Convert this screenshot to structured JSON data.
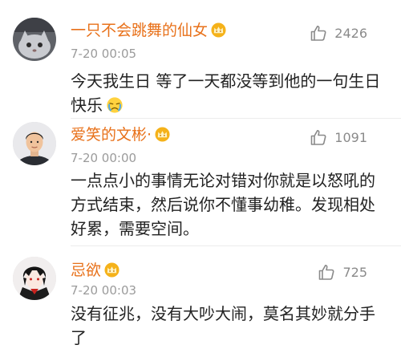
{
  "comments": [
    {
      "username": "一只不会跳舞的仙女",
      "avatar_icon": "grey-cat-avatar",
      "badge_icon": "vip-crown-badge-icon",
      "time": "7-20 00:05",
      "likes": "2426",
      "content": "今天我生日 等了一天都没等到他的一句生日快乐",
      "content_emoji": "sad-face-emoji"
    },
    {
      "username": "爱笑的文彬·",
      "avatar_icon": "young-man-avatar",
      "badge_icon": "vip-crown-badge-icon",
      "time": "7-20 00:00",
      "likes": "1091",
      "content": "一点点小的事情无论对错对你就是以怒吼的方式结束，然后说你不懂事幼稚。发现相处好累，需要空间。"
    },
    {
      "username": "忌欲",
      "avatar_icon": "anime-boy-avatar",
      "badge_icon": "vip-crown-badge-icon",
      "time": "7-20 00:03",
      "likes": "725",
      "content": "没有征兆，没有大吵大闹，莫名其妙就分手了"
    }
  ],
  "colors": {
    "username": "#e8711a",
    "text": "#222222",
    "meta": "#9b9b9b",
    "like": "#8a8a8a"
  }
}
